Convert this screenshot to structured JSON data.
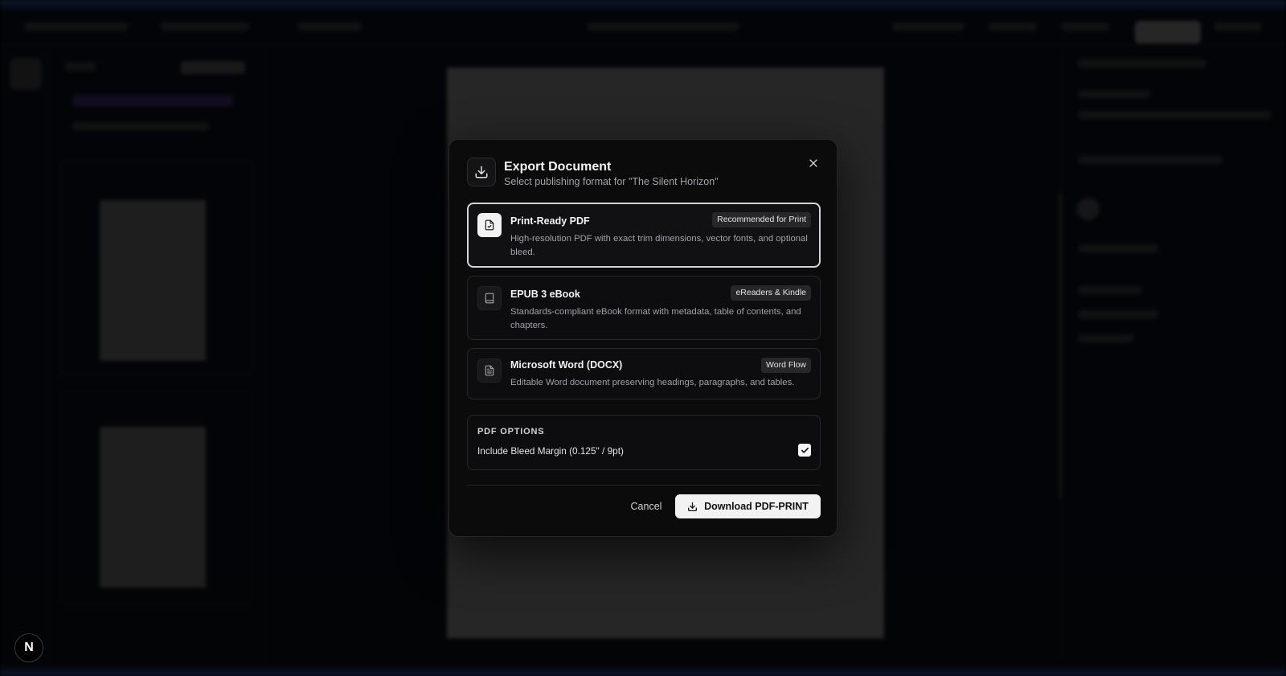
{
  "app": {
    "fab_letter": "N"
  },
  "modal": {
    "title": "Export Document",
    "subtitle": "Select publishing format for \"The Silent Horizon\"",
    "options": [
      {
        "title": "Print-Ready PDF",
        "badge": "Recommended for Print",
        "description": "High-resolution PDF with exact trim dimensions, vector fonts, and optional bleed.",
        "icon": "file-check-icon",
        "selected": true
      },
      {
        "title": "EPUB 3 eBook",
        "badge": "eReaders & Kindle",
        "description": "Standards-compliant eBook format with metadata, table of contents, and chapters.",
        "icon": "book-icon",
        "selected": false
      },
      {
        "title": "Microsoft Word (DOCX)",
        "badge": "Word Flow",
        "description": "Editable Word document preserving headings, paragraphs, and tables.",
        "icon": "file-text-icon",
        "selected": false
      }
    ],
    "pdf_options": {
      "heading": "PDF OPTIONS",
      "bleed_label": "Include Bleed Margin (0.125\" / 9pt)",
      "bleed_checked": true
    },
    "actions": {
      "cancel_label": "Cancel",
      "download_label": "Download PDF-PRINT"
    }
  },
  "colors": {
    "modal_bg": "#0b0b0c",
    "border": "#27272a",
    "selected_border": "#d4d4d8",
    "primary_button": "#f2f2f2",
    "muted_text": "#a1a1aa"
  }
}
